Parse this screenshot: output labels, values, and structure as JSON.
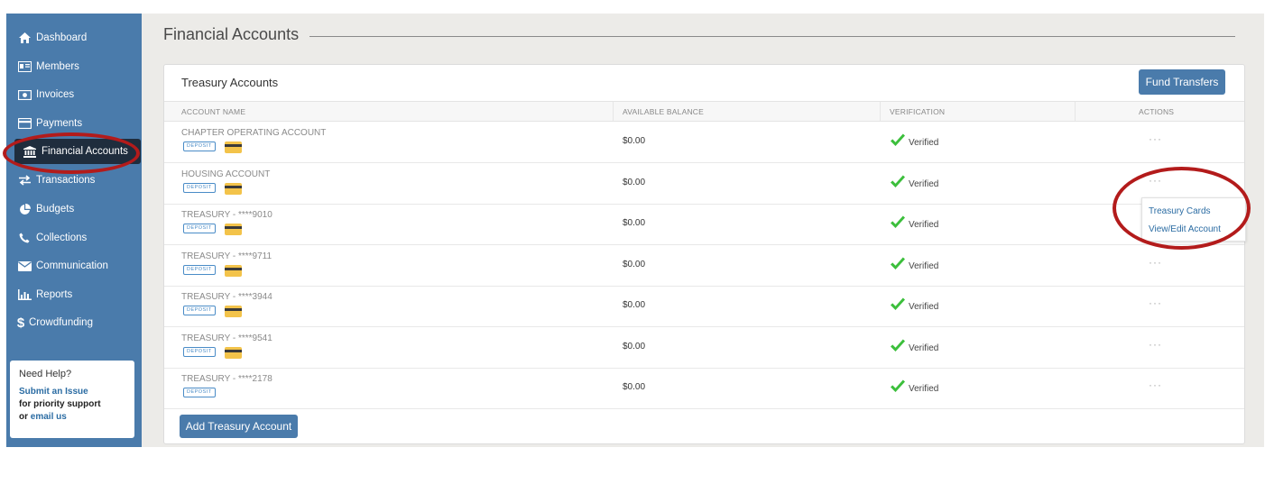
{
  "sidebar": {
    "items": [
      {
        "label": "Dashboard",
        "icon": "home-icon"
      },
      {
        "label": "Members",
        "icon": "id-card-icon"
      },
      {
        "label": "Invoices",
        "icon": "money-icon"
      },
      {
        "label": "Payments",
        "icon": "credit-card-icon"
      },
      {
        "label": "Financial Accounts",
        "icon": "bank-icon",
        "active": true
      },
      {
        "label": "Transactions",
        "icon": "exchange-icon"
      },
      {
        "label": "Budgets",
        "icon": "pie-chart-icon"
      },
      {
        "label": "Collections",
        "icon": "phone-icon"
      },
      {
        "label": "Communication",
        "icon": "envelope-icon"
      },
      {
        "label": "Reports",
        "icon": "bar-chart-icon"
      },
      {
        "label": "Crowdfunding",
        "icon": "dollar-icon"
      }
    ],
    "help": {
      "title": "Need Help?",
      "link_label": "Submit an Issue",
      "priority_text": "for priority support",
      "or_text": "or",
      "email_label": "email us"
    }
  },
  "page": {
    "title": "Financial Accounts"
  },
  "card": {
    "title": "Treasury Accounts",
    "fund_button": "Fund Transfers",
    "add_button": "Add Treasury Account",
    "columns": [
      "ACCOUNT NAME",
      "AVAILABLE BALANCE",
      "VERIFICATION",
      "ACTIONS"
    ],
    "badge_label": "DEPOSIT",
    "rows": [
      {
        "name": "CHAPTER OPERATING ACCOUNT",
        "balance": "$0.00",
        "verification": "Verified",
        "has_card": true,
        "actions": "···"
      },
      {
        "name": "HOUSING ACCOUNT",
        "balance": "$0.00",
        "verification": "Verified",
        "has_card": true,
        "actions": "···"
      },
      {
        "name": "TREASURY - ****9010",
        "balance": "$0.00",
        "verification": "Verified",
        "has_card": true,
        "actions": ""
      },
      {
        "name": "TREASURY - ****9711",
        "balance": "$0.00",
        "verification": "Verified",
        "has_card": true,
        "actions": "···"
      },
      {
        "name": "TREASURY - ****3944",
        "balance": "$0.00",
        "verification": "Verified",
        "has_card": true,
        "actions": "···"
      },
      {
        "name": "TREASURY - ****9541",
        "balance": "$0.00",
        "verification": "Verified",
        "has_card": true,
        "actions": "···"
      },
      {
        "name": "TREASURY - ****2178",
        "balance": "$0.00",
        "verification": "Verified",
        "has_card": false,
        "actions": "···"
      }
    ],
    "dropdown": [
      "Treasury Cards",
      "View/Edit Account"
    ]
  },
  "colors": {
    "sidebar": "#4a7bab",
    "active_nav": "#1f2d3d",
    "button": "#4a7bab",
    "verified_check": "#3cbf3c",
    "highlight": "#b31b1b",
    "link": "#2b6ca3"
  }
}
